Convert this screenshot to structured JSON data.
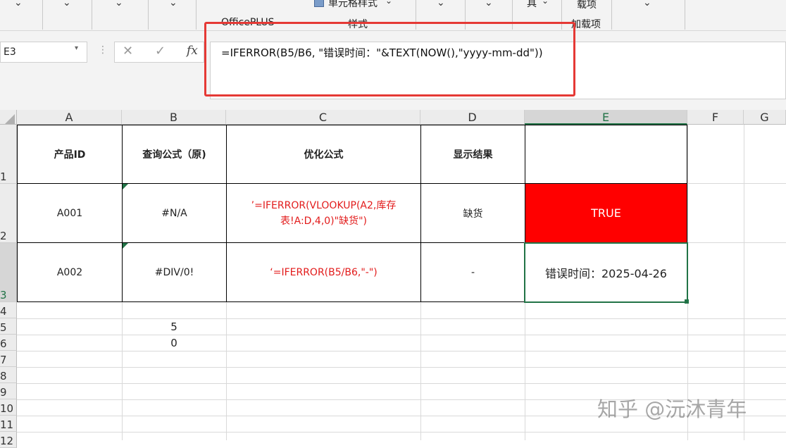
{
  "ribbon": {
    "officeplus_label": "OfficePLUS",
    "cell_style_label": "单元格样式",
    "styles_group_label": "样式",
    "tools_fragment": "具",
    "addins_fragment": "载项",
    "addins_group_label": "加载项"
  },
  "formula_bar": {
    "name_box": "E3",
    "formula": "=IFERROR(B5/B6, \"错误时间：\"&TEXT(NOW(),\"yyyy-mm-dd\"))",
    "cancel_symbol": "✕",
    "enter_symbol": "✓",
    "fx_label": "fx"
  },
  "columns": [
    "A",
    "B",
    "C",
    "D",
    "E",
    "F",
    "G"
  ],
  "rows": [
    "1",
    "2",
    "3",
    "4",
    "5",
    "6",
    "7",
    "8",
    "9",
    "10",
    "11",
    "12"
  ],
  "table": {
    "headers": [
      "产品ID",
      "查询公式（原)",
      "优化公式",
      "显示结果",
      ""
    ],
    "rows": [
      [
        "A001",
        "#N/A",
        "’=IFERROR(VLOOKUP(A2,库存表!A:D,4,0)\"缺货\")",
        "缺货",
        "TRUE"
      ],
      [
        "A002",
        "#DIV/0!",
        "‘=IFERROR(B5/B6,\"-\")",
        "-",
        "错误时间：2025-04-26"
      ]
    ]
  },
  "extra_cells": {
    "b5": "5",
    "b6": "0"
  },
  "colors": {
    "highlight": "#e53935",
    "true_cell": "#ff0000",
    "excel_green": "#217346",
    "formula_red": "#e21b1b"
  },
  "watermark": "知乎 @沅沐青年"
}
